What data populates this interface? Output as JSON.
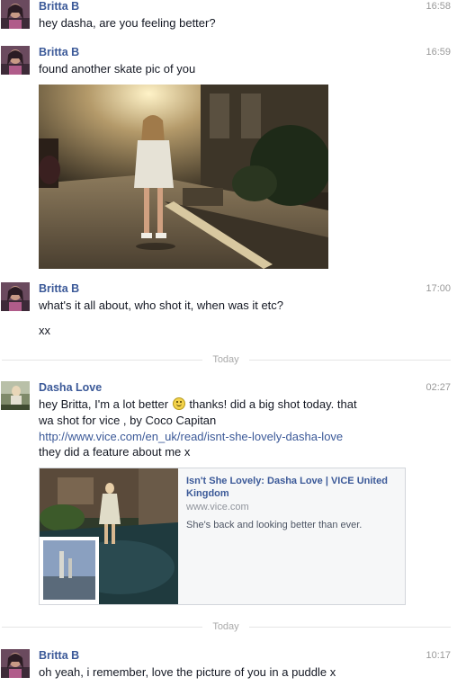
{
  "conversation": {
    "messages": [
      {
        "sender": "Britta B",
        "time": "16:58",
        "lines": [
          "hey dasha, are you feeling better?"
        ]
      },
      {
        "sender": "Britta B",
        "time": "16:59",
        "lines": [
          "found another skate pic of you"
        ]
      },
      {
        "sender": "Britta B",
        "time": "17:00",
        "lines": [
          "what's it all about, who shot it, when was it etc?",
          "xx"
        ]
      },
      {
        "sender": "Dasha Love",
        "time": "02:27",
        "line1_before_emoji": "hey Britta, I'm a lot better",
        "line1_after_emoji": "thanks! did a big shot today. that",
        "line2": "wa shot for vice , by Coco Capitan",
        "link": "http://www.vice.com/en_uk/read/isnt-she-lovely-dasha-love",
        "line4": "they did a feature about me x"
      },
      {
        "sender": "Britta B",
        "time": "10:17",
        "lines": [
          "oh yeah, i remember, love the picture of you in a puddle x"
        ]
      }
    ],
    "dividers": [
      "Today",
      "Today"
    ],
    "attachment": {
      "title": "Isn't She Lovely: Dasha Love | VICE United Kingdom",
      "domain": "www.vice.com",
      "description": "She's back and looking better than ever."
    },
    "emoji": "smiley-icon"
  },
  "colors": {
    "name": "#3b5998",
    "link": "#3b5998",
    "time": "#999999",
    "divider_line": "#e5e5e5"
  }
}
